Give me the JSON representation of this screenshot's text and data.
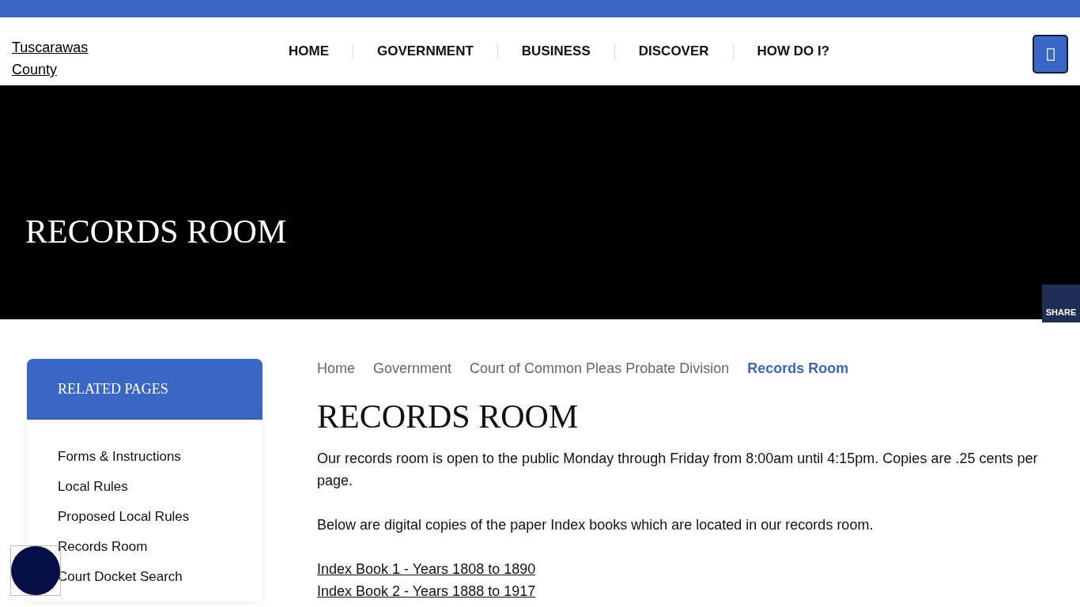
{
  "logo": {
    "lines": [
      "Tuscarawas",
      "County"
    ]
  },
  "nav": [
    {
      "label": "HOME"
    },
    {
      "label": "GOVERNMENT"
    },
    {
      "label": "BUSINESS"
    },
    {
      "label": "DISCOVER"
    },
    {
      "label": "HOW DO I?"
    }
  ],
  "hero": {
    "title": "RECORDS ROOM",
    "share": "SHARE"
  },
  "sidebar": {
    "title": "RELATED PAGES",
    "items": [
      "Forms & Instructions",
      "Local Rules",
      "Proposed Local Rules",
      "Records Room",
      "Court Docket Search"
    ]
  },
  "breadcrumb": [
    {
      "label": "Home",
      "selected": false
    },
    {
      "label": "Government",
      "selected": false
    },
    {
      "label": "Court of Common Pleas Probate Division",
      "selected": false
    },
    {
      "label": "Records Room",
      "selected": true
    }
  ],
  "content": {
    "title": "RECORDS ROOM",
    "paragraphs": [
      "Our records room is open to the public Monday through Friday from 8:00am until 4:15pm.  Copies are .25 cents per page.",
      "Below are digital copies of the paper Index books which are located in our records room."
    ],
    "links": [
      "Index Book 1 - Years 1808 to 1890",
      "Index Book 2 - Years 1888 to 1917"
    ]
  }
}
